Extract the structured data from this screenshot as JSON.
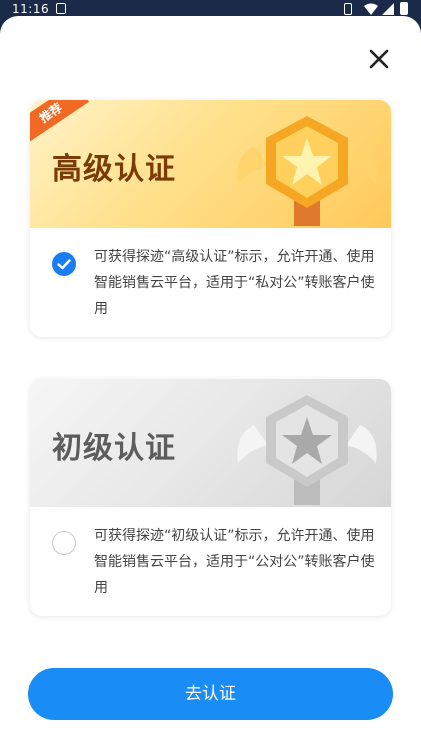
{
  "status_bar": {
    "time": "11:16"
  },
  "colors": {
    "accent": "#1a8cf5",
    "gold_title": "#7a3b06",
    "ribbon": "#f06a25",
    "check": "#1a7ef2"
  },
  "close_icon": "close-icon",
  "options": [
    {
      "ribbon": "推荐",
      "title": "高级认证",
      "selected": true,
      "description": "可获得探迹“高级认证”标示，允许开通、使用智能销售云平台，适用于“私对公”转账客户使用"
    },
    {
      "title": "初级认证",
      "selected": false,
      "description": "可获得探迹“初级认证”标示，允许开通、使用智能销售云平台，适用于“公对公”转账客户使用"
    }
  ],
  "submit_label": "去认证"
}
